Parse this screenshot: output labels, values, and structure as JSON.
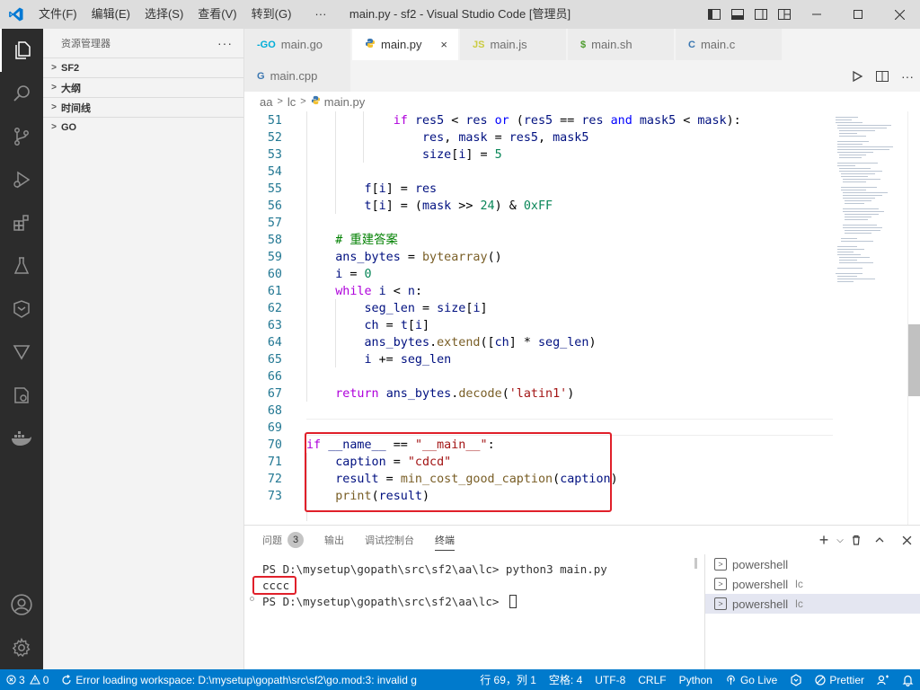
{
  "titlebar": {
    "menus": [
      "文件(F)",
      "编辑(E)",
      "选择(S)",
      "查看(V)",
      "转到(G)",
      "···"
    ],
    "window_title": "main.py - sf2 - Visual Studio Code [管理员]"
  },
  "activity_bar": {
    "icons": [
      "explorer-icon",
      "search-icon",
      "source-control-icon",
      "run-debug-icon",
      "extensions-icon",
      "testing-icon",
      "remote-icon",
      "go-outline-icon",
      "container-icon",
      "docker-icon",
      "account-icon",
      "settings-icon"
    ]
  },
  "sidebar": {
    "title": "资源管理器",
    "more": "···",
    "sections": [
      "SF2",
      "大纲",
      "时间线",
      "GO"
    ]
  },
  "tabs": [
    {
      "icon": "-GO",
      "label": "main.go",
      "color": "#00add8"
    },
    {
      "icon": "⬩",
      "label": "main.py",
      "color": "#3b77b1",
      "close": "×"
    },
    {
      "icon": "JS",
      "label": "main.js",
      "color": "#cbcb41"
    },
    {
      "icon": "$",
      "label": "main.sh",
      "color": "#4d9c2d"
    },
    {
      "icon": "C",
      "label": "main.c",
      "color": "#3b77b1"
    },
    {
      "icon": "G",
      "label": "main.cpp",
      "color": "#3b77b1"
    }
  ],
  "breadcrumb": {
    "parts": [
      "aa",
      "lc",
      "main.py"
    ]
  },
  "code": {
    "lines": [
      {
        "n": "51",
        "html": "            <span class=\"ctl\">if</span> <span class=\"var\">res5</span> &lt; <span class=\"var\">res</span> <span class=\"kw\">or</span> (<span class=\"var\">res5</span> == <span class=\"var\">res</span> <span class=\"kw\">and</span> <span class=\"var\">mask5</span> &lt; <span class=\"var\">mask</span>):"
      },
      {
        "n": "52",
        "html": "                <span class=\"var\">res</span>, <span class=\"var\">mask</span> = <span class=\"var\">res5</span>, <span class=\"var\">mask5</span>"
      },
      {
        "n": "53",
        "html": "                <span class=\"var\">size</span>[<span class=\"var\">i</span>] = <span class=\"num\">5</span>"
      },
      {
        "n": "54",
        "html": ""
      },
      {
        "n": "55",
        "html": "        <span class=\"var\">f</span>[<span class=\"var\">i</span>] = <span class=\"var\">res</span>"
      },
      {
        "n": "56",
        "html": "        <span class=\"var\">t</span>[<span class=\"var\">i</span>] = (<span class=\"var\">mask</span> &gt;&gt; <span class=\"num\">24</span>) &amp; <span class=\"num\">0xFF</span>"
      },
      {
        "n": "57",
        "html": ""
      },
      {
        "n": "58",
        "html": "    <span class=\"cmt\"># 重建答案</span>"
      },
      {
        "n": "59",
        "html": "    <span class=\"var\">ans_bytes</span> = <span class=\"fn\">bytearray</span>()"
      },
      {
        "n": "60",
        "html": "    <span class=\"var\">i</span> = <span class=\"num\">0</span>"
      },
      {
        "n": "61",
        "html": "    <span class=\"ctl\">while</span> <span class=\"var\">i</span> &lt; <span class=\"var\">n</span>:"
      },
      {
        "n": "62",
        "html": "        <span class=\"var\">seg_len</span> = <span class=\"var\">size</span>[<span class=\"var\">i</span>]"
      },
      {
        "n": "63",
        "html": "        <span class=\"var\">ch</span> = <span class=\"var\">t</span>[<span class=\"var\">i</span>]"
      },
      {
        "n": "64",
        "html": "        <span class=\"var\">ans_bytes</span>.<span class=\"fn\">extend</span>([<span class=\"var\">ch</span>] * <span class=\"var\">seg_len</span>)"
      },
      {
        "n": "65",
        "html": "        <span class=\"var\">i</span> += <span class=\"var\">seg_len</span>"
      },
      {
        "n": "66",
        "html": ""
      },
      {
        "n": "67",
        "html": "    <span class=\"ctl\">return</span> <span class=\"var\">ans_bytes</span>.<span class=\"fn\">decode</span>(<span class=\"str\">'latin1'</span>)"
      },
      {
        "n": "68",
        "html": ""
      },
      {
        "n": "69",
        "html": ""
      },
      {
        "n": "70",
        "html": "<span class=\"ctl\">if</span> <span class=\"var\">__name__</span> == <span class=\"str\">\"__main__\"</span>:"
      },
      {
        "n": "71",
        "html": "    <span class=\"var\">caption</span> = <span class=\"str\">\"cdcd\"</span>"
      },
      {
        "n": "72",
        "html": "    <span class=\"var\">result</span> = <span class=\"fn\">min_cost_good_caption</span>(<span class=\"var\">caption</span>)"
      },
      {
        "n": "73",
        "html": "    <span class=\"fn\">print</span>(<span class=\"var\">result</span>)"
      }
    ]
  },
  "panel": {
    "tabs": [
      "问题",
      "输出",
      "调试控制台",
      "终端"
    ],
    "problems_count": "3",
    "terminal_lines": [
      "PS D:\\mysetup\\gopath\\src\\sf2\\aa\\lc> python3 main.py",
      "cccc",
      "PS D:\\mysetup\\gopath\\src\\sf2\\aa\\lc> "
    ],
    "terminals": [
      {
        "label": "powershell",
        "sub": ""
      },
      {
        "label": "powershell",
        "sub": "lc"
      },
      {
        "label": "powershell",
        "sub": "lc"
      }
    ]
  },
  "statusbar": {
    "errors": "3",
    "warnings": "0",
    "message": "Error loading workspace: D:\\mysetup\\gopath\\src\\sf2\\go.mod:3: invalid g",
    "position": "行 69，列 1",
    "spaces": "空格: 4",
    "encoding": "UTF-8",
    "eol": "CRLF",
    "language": "Python",
    "golive": "Go Live",
    "prettier": "Prettier"
  },
  "colors": {
    "accent": "#007acc",
    "highlight_red": "#e0202a"
  }
}
